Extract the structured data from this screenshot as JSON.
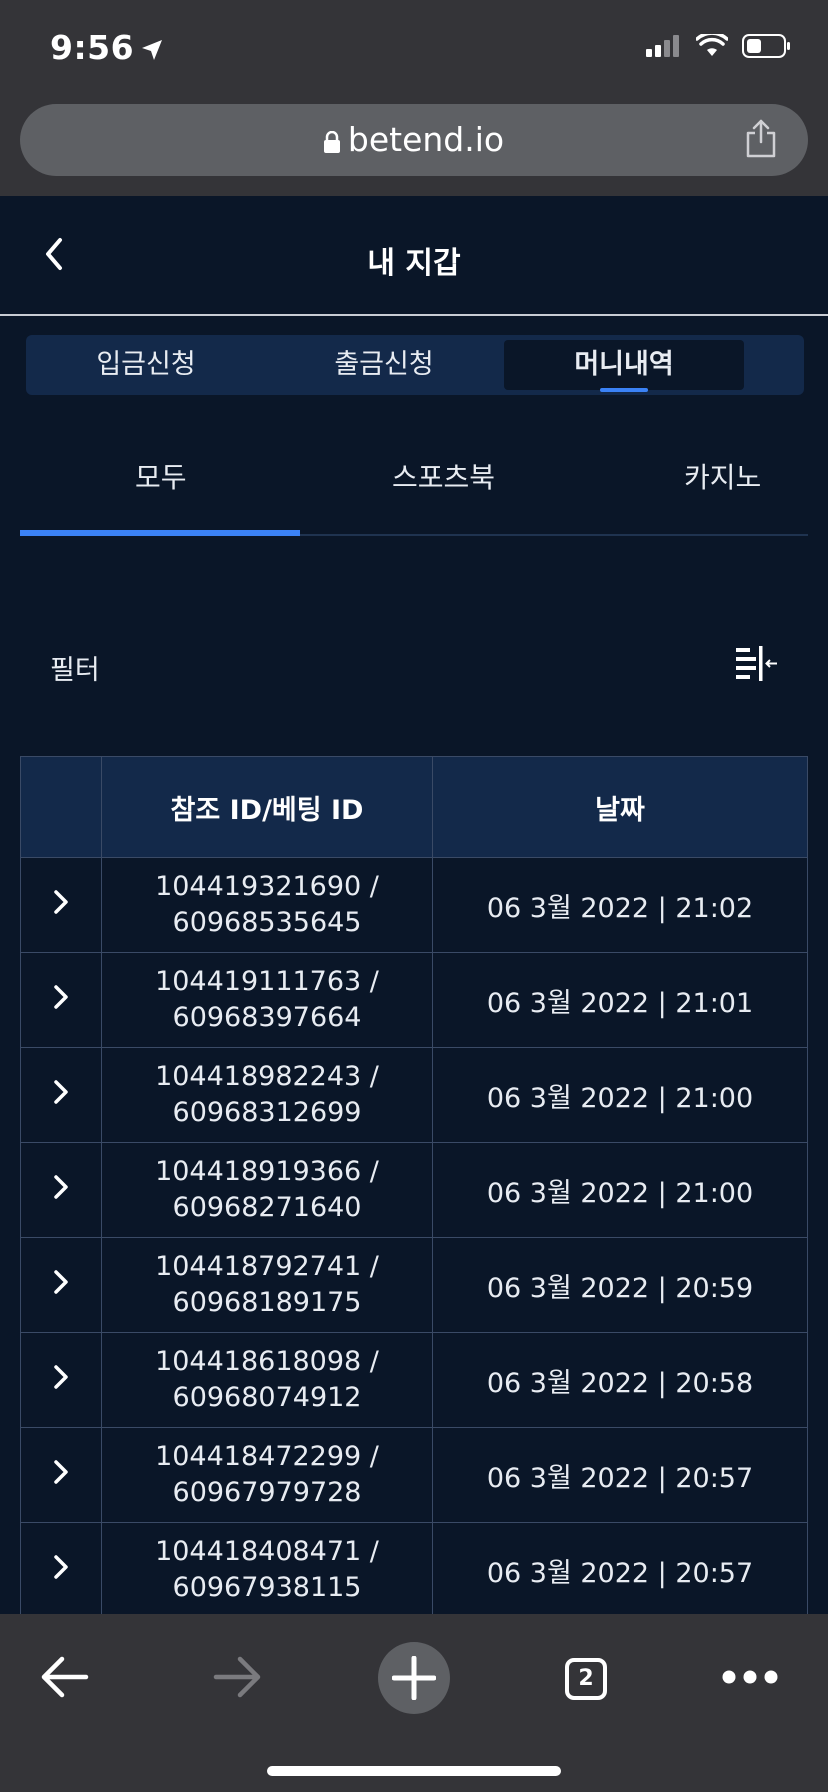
{
  "status": {
    "time": "9:56"
  },
  "browser": {
    "url": "betend.io",
    "tab_count": "2"
  },
  "header": {
    "title": "내 지갑"
  },
  "segments": [
    {
      "label": "입금신청",
      "active": false
    },
    {
      "label": "출금신청",
      "active": false
    },
    {
      "label": "머니내역",
      "active": true
    }
  ],
  "subtabs": [
    {
      "label": "모두",
      "active": true
    },
    {
      "label": "스포츠북",
      "active": false
    },
    {
      "label": "카지노",
      "active": false
    }
  ],
  "filter": {
    "label": "필터"
  },
  "table": {
    "headers": [
      "참조 ID/베팅 ID",
      "날짜"
    ],
    "rows": [
      {
        "ref": "104419321690 /",
        "bet": "60968535645",
        "date": "06 3월 2022 | 21:02"
      },
      {
        "ref": "104419111763 /",
        "bet": "60968397664",
        "date": "06 3월 2022 | 21:01"
      },
      {
        "ref": "104418982243 /",
        "bet": "60968312699",
        "date": "06 3월 2022 | 21:00"
      },
      {
        "ref": "104418919366 /",
        "bet": "60968271640",
        "date": "06 3월 2022 | 21:00"
      },
      {
        "ref": "104418792741 /",
        "bet": "60968189175",
        "date": "06 3월 2022 | 20:59"
      },
      {
        "ref": "104418618098 /",
        "bet": "60968074912",
        "date": "06 3월 2022 | 20:58"
      },
      {
        "ref": "104418472299 /",
        "bet": "60967979728",
        "date": "06 3월 2022 | 20:57"
      },
      {
        "ref": "104418408471 /",
        "bet": "60967938115",
        "date": "06 3월 2022 | 20:57"
      }
    ]
  },
  "colors": {
    "background": "#0a1628",
    "panel": "#13294a",
    "accent": "#3b82f6",
    "chrome": "#343438"
  },
  "icons": [
    "location-arrow-icon",
    "cellular-signal-icon",
    "wifi-icon",
    "battery-icon",
    "lock-icon",
    "share-icon",
    "chevron-left-icon",
    "filter-collapse-icon",
    "chevron-right-icon",
    "arrow-left-icon",
    "arrow-right-icon",
    "plus-icon",
    "tabs-icon",
    "more-icon"
  ]
}
